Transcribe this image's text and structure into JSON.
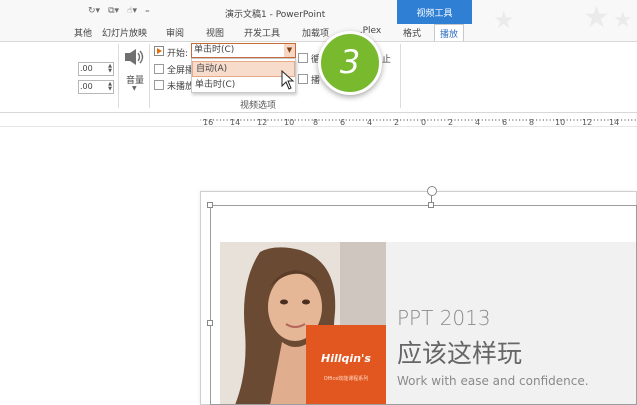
{
  "window": {
    "title": "演示文稿1 - PowerPoint",
    "context_group": "视频工具"
  },
  "tabs": [
    {
      "label": "其他",
      "active": false
    },
    {
      "label": "幻灯片放映",
      "active": false
    },
    {
      "label": "审阅",
      "active": false
    },
    {
      "label": "视图",
      "active": false
    },
    {
      "label": "开发工具",
      "active": false
    },
    {
      "label": "加载项",
      "active": false
    },
    {
      "label": "...Plex",
      "active": false
    },
    {
      "label": "格式",
      "active": false
    },
    {
      "label": "播放",
      "active": true
    }
  ],
  "ribbon": {
    "fade_in_value": ".00",
    "fade_out_value": ".00",
    "volume_label": "音量",
    "start_label": "开始:",
    "start_value": "单击时(C)",
    "fullscreen_label": "全屏播",
    "no_play_hide_label": "未播放",
    "loop_label_partial": "循",
    "rewind_label_partial": "播",
    "stop_label_partial": "止",
    "group_label": "视频选项"
  },
  "dropdown": {
    "options": [
      {
        "label": "自动(A)",
        "highlighted": true
      },
      {
        "label": "单击时(C)",
        "highlighted": false
      }
    ]
  },
  "step_badge": "3",
  "ruler": {
    "labels": [
      "16",
      "14",
      "12",
      "10",
      "8",
      "6",
      "4",
      "2",
      "0",
      "2",
      "4",
      "6",
      "8",
      "10",
      "12",
      "14",
      "16"
    ]
  },
  "slide": {
    "brand_name": "Hillqin's",
    "brand_sub": "Office效能课程系列",
    "year_line": "PPT 2013",
    "title_line": "应该这样玩",
    "subtitle_line": "Work with ease and confidence."
  },
  "colors": {
    "context_blue": "#2f7fd5",
    "badge_green": "#78b92e",
    "brand_orange": "#e2571f",
    "highlight_orange": "#f7dccc"
  }
}
